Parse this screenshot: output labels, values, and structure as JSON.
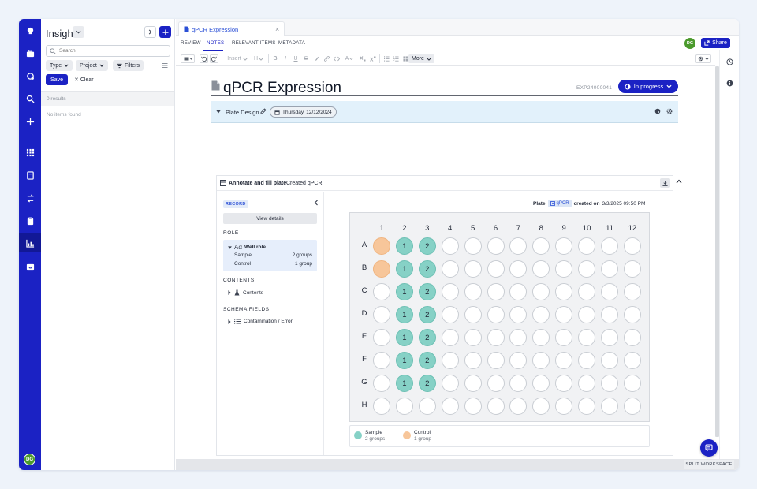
{
  "sidebar": {
    "title": "Insights",
    "search_placeholder": "Search",
    "filters": {
      "type": "Type",
      "project": "Project",
      "filters": "Filters"
    },
    "save_label": "Save",
    "clear_label": "Clear",
    "results": "0 results",
    "empty": "No items found",
    "avatar": "DG"
  },
  "tab": {
    "label": "qPCR Expression"
  },
  "subtabs": [
    "REVIEW",
    "NOTES",
    "RELEVANT ITEMS",
    "METADATA"
  ],
  "header": {
    "avatar": "DG",
    "share_label": "Share"
  },
  "toolbar": {
    "insert": "Insert",
    "heading": "H",
    "more": "More"
  },
  "document": {
    "title": "qPCR Expression",
    "id": "EXP24000041",
    "status": "In progress",
    "section_title": "Plate Design",
    "date": "Thursday, 12/12/2024"
  },
  "card": {
    "title": "Annotate and fill plate",
    "subtitle": "Created qPCR",
    "record_tag": "RECORD",
    "view_details": "View details",
    "role_heading": "ROLE",
    "well_role": "Well role",
    "roles": [
      {
        "name": "Sample",
        "count": "2 groups"
      },
      {
        "name": "Control",
        "count": "1 group"
      }
    ],
    "contents_heading": "CONTENTS",
    "contents_item": "Contents",
    "schema_heading": "SCHEMA FIELDS",
    "schema_item": "Contamination / Error"
  },
  "plate": {
    "label": "Plate",
    "chip": "qPCR",
    "created_on_label": "created on",
    "created_on": "3/3/2025 09:50 PM",
    "columns": [
      "1",
      "2",
      "3",
      "4",
      "5",
      "6",
      "7",
      "8",
      "9",
      "10",
      "11",
      "12"
    ],
    "rows": [
      "A",
      "B",
      "C",
      "D",
      "E",
      "F",
      "G",
      "H"
    ],
    "wells": {
      "A": [
        "control",
        "sample:1",
        "sample:2",
        "",
        "",
        "",
        "",
        "",
        "",
        "",
        "",
        ""
      ],
      "B": [
        "control",
        "sample:1",
        "sample:2",
        "",
        "",
        "",
        "",
        "",
        "",
        "",
        "",
        ""
      ],
      "C": [
        "",
        "sample:1",
        "sample:2",
        "",
        "",
        "",
        "",
        "",
        "",
        "",
        "",
        ""
      ],
      "D": [
        "",
        "sample:1",
        "sample:2",
        "",
        "",
        "",
        "",
        "",
        "",
        "",
        "",
        ""
      ],
      "E": [
        "",
        "sample:1",
        "sample:2",
        "",
        "",
        "",
        "",
        "",
        "",
        "",
        "",
        ""
      ],
      "F": [
        "",
        "sample:1",
        "sample:2",
        "",
        "",
        "",
        "",
        "",
        "",
        "",
        "",
        ""
      ],
      "G": [
        "",
        "sample:1",
        "sample:2",
        "",
        "",
        "",
        "",
        "",
        "",
        "",
        "",
        ""
      ],
      "H": [
        "",
        "",
        "",
        "",
        "",
        "",
        "",
        "",
        "",
        "",
        "",
        ""
      ]
    },
    "legend": [
      {
        "name": "Sample",
        "count": "2 groups",
        "color": "#86d1c6"
      },
      {
        "name": "Control",
        "count": "1 group",
        "color": "#f7c69a"
      }
    ]
  },
  "footer": {
    "split_label": "SPLIT WORKSPACE"
  },
  "colors": {
    "brand": "#1b22c4",
    "sample": "#86d1c6",
    "control": "#f7c69a",
    "section_bg": "#e2f1fb"
  }
}
